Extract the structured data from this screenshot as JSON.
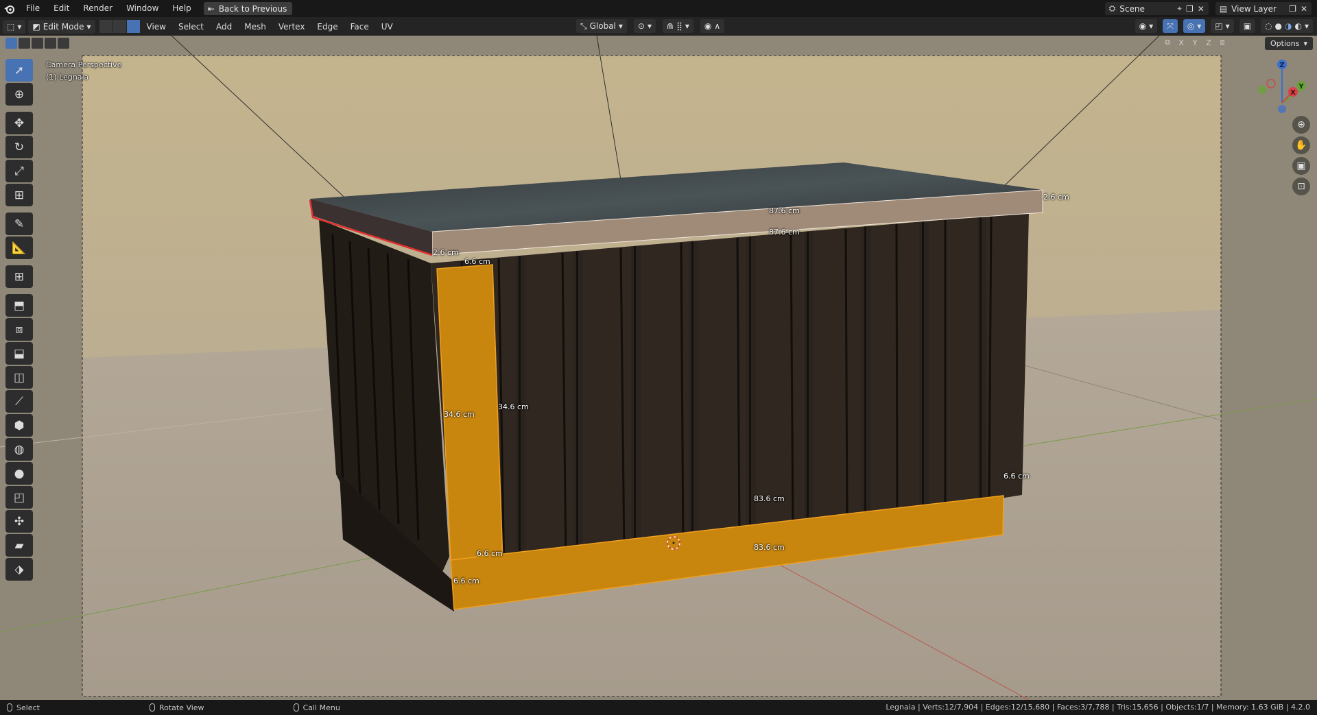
{
  "topbar": {
    "menus": [
      "File",
      "Edit",
      "Render",
      "Window",
      "Help"
    ],
    "back_button": "Back to Previous",
    "scene_name": "Scene",
    "view_layer": "View Layer"
  },
  "header": {
    "mode": "Edit Mode",
    "menus": [
      "View",
      "Select",
      "Add",
      "Mesh",
      "Vertex",
      "Edge",
      "Face",
      "UV"
    ],
    "orientation": "Global",
    "options_label": "Options",
    "axes": [
      "X",
      "Y",
      "Z"
    ]
  },
  "viewport": {
    "camera_label": "Camera Perspective",
    "object_label": "(1) Legnaia",
    "measurements": {
      "top_front_upper": "87.6 cm",
      "top_front_lower": "87.6 cm",
      "top_right_thickness": "2.6 cm",
      "top_left_thickness": "2.6 cm",
      "leg_top_width": "6.6 cm",
      "leg_height_left": "34.6 cm",
      "leg_height_right": "34.6 cm",
      "leg_bottom_width": "6.6 cm",
      "leg_bottom_depth": "6.6 cm",
      "base_length_upper": "83.6 cm",
      "base_length_lower": "83.6 cm",
      "base_right_height": "6.6 cm"
    },
    "gizmo": {
      "x": "X",
      "y": "Y",
      "z": "Z"
    }
  },
  "status": {
    "hint_select": "Select",
    "hint_rotate": "Rotate View",
    "hint_menu": "Call Menu",
    "stats": "Legnaia | Verts:12/7,904 | Edges:12/15,680 | Faces:3/7,788 | Tris:15,656 | Objects:1/7 | Memory: 1.63 GiB | 4.2.0"
  },
  "colors": {
    "selected_face": "#c8860f",
    "active_edge": "#e03030",
    "ui_accent": "#4772b3"
  }
}
